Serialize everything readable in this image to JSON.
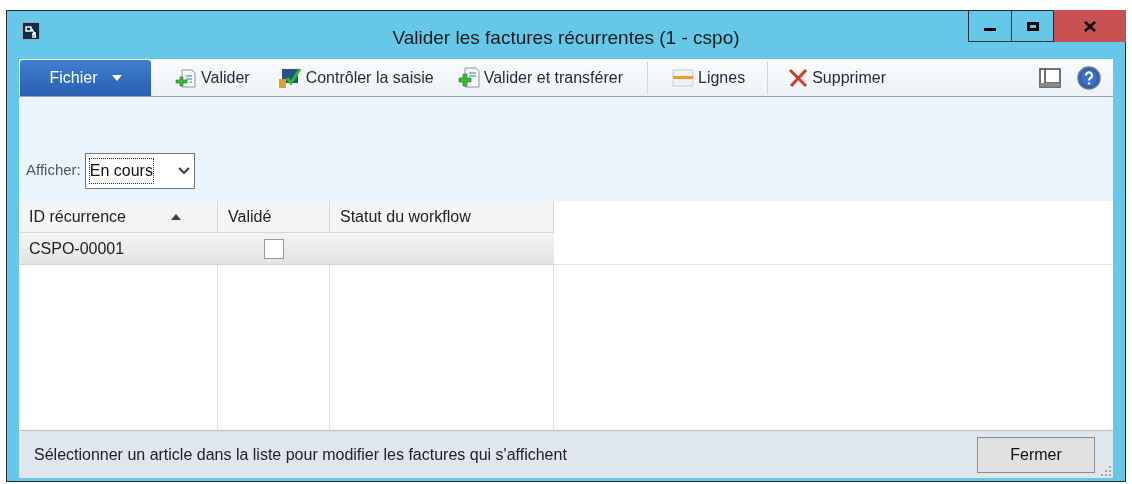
{
  "window": {
    "title": "Valider les factures récurrentes (1 - cspo)"
  },
  "file_menu": {
    "label": "Fichier"
  },
  "toolbar": [
    {
      "kind": "validate",
      "label": "Valider"
    },
    {
      "kind": "check",
      "label": "Contrôler la saisie"
    },
    {
      "kind": "transfer",
      "label": "Valider et transférer"
    },
    {
      "kind": "lines",
      "label": "Lignes"
    },
    {
      "kind": "delete",
      "label": "Supprimer"
    }
  ],
  "filter": {
    "label": "Afficher:",
    "value": "En cours"
  },
  "table": {
    "columns": [
      {
        "label": "ID récurrence",
        "sorted": true
      },
      {
        "label": "Validé",
        "sorted": false
      },
      {
        "label": "Statut du workflow",
        "sorted": false
      }
    ],
    "rows": [
      {
        "id": "CSPO-00001",
        "validated": false,
        "selected": true
      }
    ]
  },
  "status_bar": {
    "text": "Sélectionner un article dans la liste pour modifier les factures qui s'affichent",
    "button": "Fermer"
  }
}
